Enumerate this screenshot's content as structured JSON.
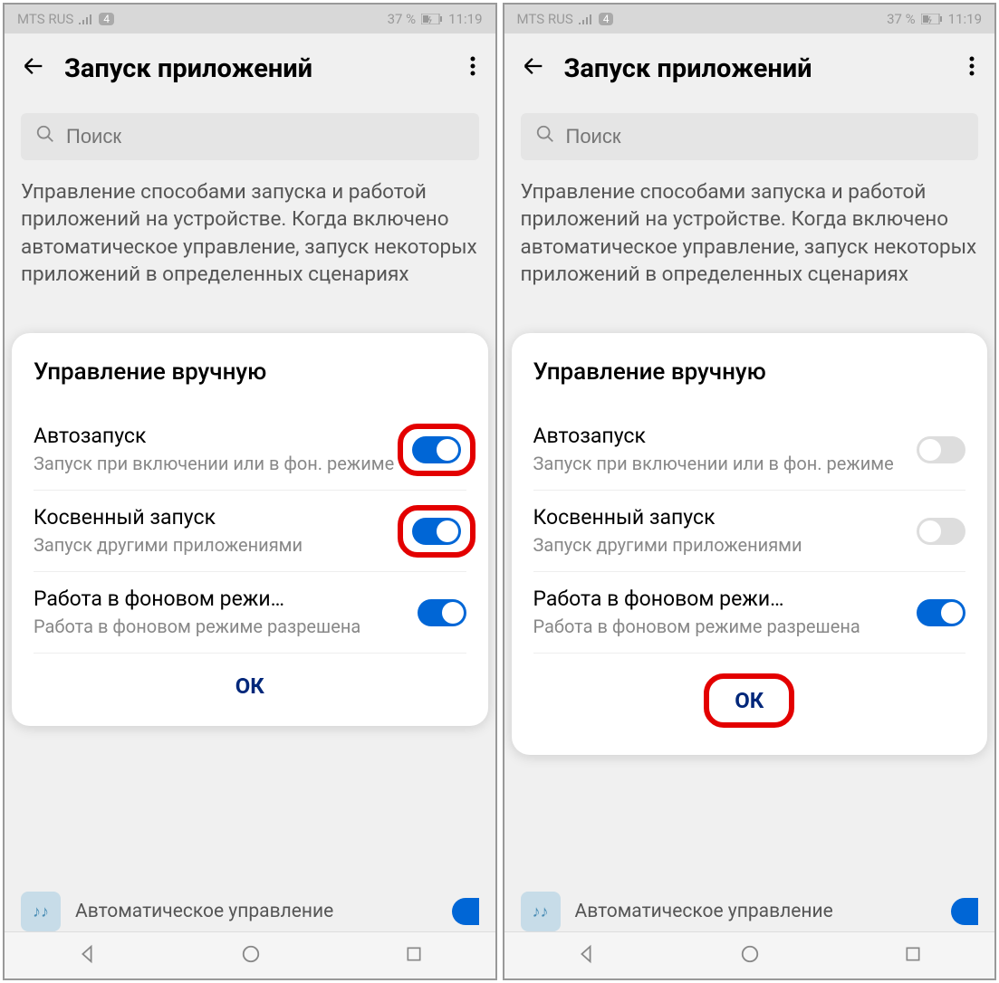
{
  "status": {
    "carrier": "MTS RUS",
    "notif_count": "4",
    "battery": "37 %",
    "time": "11:19"
  },
  "header": {
    "title": "Запуск приложений"
  },
  "search": {
    "placeholder": "Поиск"
  },
  "description": "Управление способами запуска и работой приложений на устройстве. Когда включено автоматическое управление, запуск некоторых приложений в определенных сценариях",
  "dialog": {
    "title": "Управление вручную",
    "ok": "ОК",
    "items": [
      {
        "name": "Автозапуск",
        "desc": "Запуск при включении или в фон. режиме"
      },
      {
        "name": "Косвенный запуск",
        "desc": "Запуск другими приложениями"
      },
      {
        "name": "Работа в фоновом режи…",
        "desc": "Работа в фоновом режиме разрешена"
      }
    ]
  },
  "bg_item": {
    "text": "Автоматическое управление"
  },
  "screens": [
    {
      "toggles": [
        true,
        true,
        true
      ],
      "highlight_toggles": [
        0,
        1
      ],
      "highlight_ok": false
    },
    {
      "toggles": [
        false,
        false,
        true
      ],
      "highlight_toggles": [],
      "highlight_ok": true
    }
  ]
}
